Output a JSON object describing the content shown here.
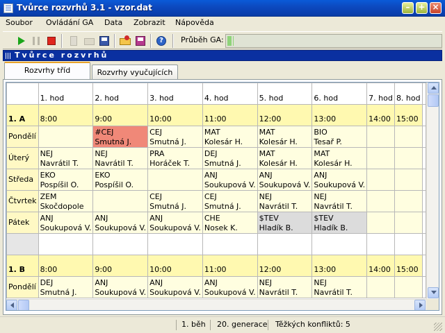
{
  "window": {
    "title": "Tvůrce rozvrhů 3.1 - vzor.dat",
    "min_symbol": "–",
    "max_symbol": "+",
    "close_symbol": "×"
  },
  "menu": [
    "Soubor",
    "Ovládání GA",
    "Data",
    "Zobrazit",
    "Nápověda"
  ],
  "toolbar": {
    "icons": [
      "play-icon",
      "pause-icon",
      "stop-icon",
      "new-document-icon",
      "open-folder-icon",
      "save-icon",
      "open-file-icon",
      "save-as-icon",
      "help-icon"
    ],
    "ga_label": "Průběh GA:",
    "ga_progress": 0.03
  },
  "panel": {
    "title": "Tvůrce rozvrhů"
  },
  "tabs": [
    "Rozvrhy tříd",
    "Rozvrhy vyučujících"
  ],
  "timetable": {
    "hours": [
      "1. hod",
      "2. hod",
      "3. hod",
      "4. hod",
      "5. hod",
      "6. hod",
      "7. hod",
      "8. hod"
    ],
    "times": [
      "8:00",
      "9:00",
      "10:00",
      "11:00",
      "12:00",
      "13:00",
      "14:00",
      "15:00"
    ],
    "class_a": {
      "name": "1. A",
      "days": [
        {
          "name": "Pondělí",
          "cells": [
            [
              "",
              ""
            ],
            [
              "#CEJ",
              "Smutná J."
            ],
            [
              "CEJ",
              "Smutná J."
            ],
            [
              "MAT",
              "Kolesár H."
            ],
            [
              "MAT",
              "Kolesár H."
            ],
            [
              "BIO",
              "Tesař P."
            ],
            [
              "",
              ""
            ],
            [
              "",
              ""
            ]
          ]
        },
        {
          "name": "Úterý",
          "cells": [
            [
              "NEJ",
              "Navrátil T."
            ],
            [
              "NEJ",
              "Navrátil T."
            ],
            [
              "PRA",
              "Horáček T."
            ],
            [
              "DEJ",
              "Smutná J."
            ],
            [
              "MAT",
              "Kolesár H."
            ],
            [
              "MAT",
              "Kolesár H."
            ],
            [
              "",
              ""
            ],
            [
              "",
              ""
            ]
          ]
        },
        {
          "name": "Středa",
          "cells": [
            [
              "EKO",
              "Pospíšil O."
            ],
            [
              "EKO",
              "Pospíšil O."
            ],
            [
              "",
              ""
            ],
            [
              "ANJ",
              "Soukupová V."
            ],
            [
              "ANJ",
              "Soukupová V."
            ],
            [
              "ANJ",
              "Soukupová V."
            ],
            [
              "",
              ""
            ],
            [
              "",
              ""
            ]
          ]
        },
        {
          "name": "Čtvrtek",
          "cells": [
            [
              "ZEM",
              "Skočdopole"
            ],
            [
              "",
              ""
            ],
            [
              "CEJ",
              "Smutná J."
            ],
            [
              "CEJ",
              "Smutná J."
            ],
            [
              "NEJ",
              "Navrátil T."
            ],
            [
              "NEJ",
              "Navrátil T."
            ],
            [
              "",
              ""
            ],
            [
              "",
              ""
            ]
          ]
        },
        {
          "name": "Pátek",
          "cells": [
            [
              "ANJ",
              "Soukupová V."
            ],
            [
              "ANJ",
              "Soukupová V."
            ],
            [
              "ANJ",
              "Soukupová V."
            ],
            [
              "CHE",
              "Nosek K."
            ],
            [
              "$TEV",
              "Hladík B."
            ],
            [
              "$TEV",
              "Hladík B."
            ],
            [
              "",
              ""
            ],
            [
              "",
              ""
            ]
          ]
        }
      ]
    },
    "class_b": {
      "name": "1. B",
      "days": [
        {
          "name": "Pondělí",
          "cells": [
            [
              "DEJ",
              "Smutná J."
            ],
            [
              "ANJ",
              "Soukupová V."
            ],
            [
              "ANJ",
              "Soukupová V."
            ],
            [
              "ANJ",
              "Soukupová V."
            ],
            [
              "NEJ",
              "Navrátil T."
            ],
            [
              "NEJ",
              "Navrátil T."
            ],
            [
              "",
              ""
            ],
            [
              "",
              ""
            ]
          ]
        }
      ]
    }
  },
  "status": {
    "run": "1. běh",
    "generation": "20. generace",
    "conflicts": "Těžkých konfliktů: 5"
  }
}
